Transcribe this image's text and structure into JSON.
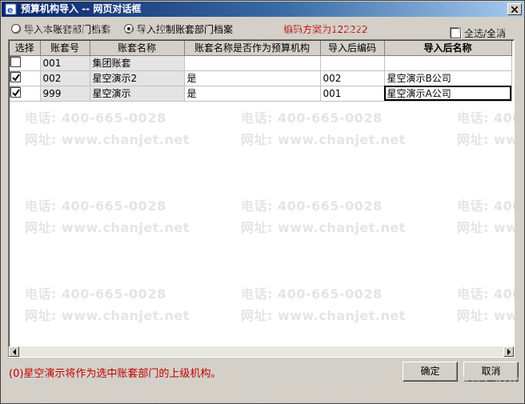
{
  "window": {
    "title": "预算机构导入  --  网页对话框"
  },
  "options": {
    "radio_local": "导入本账套部门档案",
    "radio_control": "导入控制账套部门档案",
    "selected": "control",
    "code_scheme": "编码方案为122222",
    "select_all": "全选/全消",
    "select_all_checked": false
  },
  "grid": {
    "headers": [
      "选择",
      "账套号",
      "账套名称",
      "账套名称是否作为预算机构",
      "导入后编码",
      "导入后名称"
    ],
    "rows": [
      {
        "checked": false,
        "book_no": "001",
        "book_name": "集团账套",
        "as_org": "",
        "new_code": "",
        "new_name": ""
      },
      {
        "checked": true,
        "book_no": "002",
        "book_name": "星空演示2",
        "as_org": "是",
        "new_code": "002",
        "new_name": "星空演示B公司"
      },
      {
        "checked": true,
        "book_no": "999",
        "book_name": "星空演示",
        "as_org": "是",
        "new_code": "001",
        "new_name": "星空演示A公司"
      }
    ]
  },
  "watermark": {
    "phone": "电话: 400-665-0028",
    "site": "网址: www.chanjet.net"
  },
  "status_message": "(0)星空演示将作为选中账套部门的上级机构。",
  "buttons": {
    "ok": "确定",
    "cancel": "取消"
  },
  "colors": {
    "title_start": "#0a246a",
    "title_end": "#a6caf0",
    "face": "#d4d0c8",
    "alert_text": "#c00000"
  }
}
